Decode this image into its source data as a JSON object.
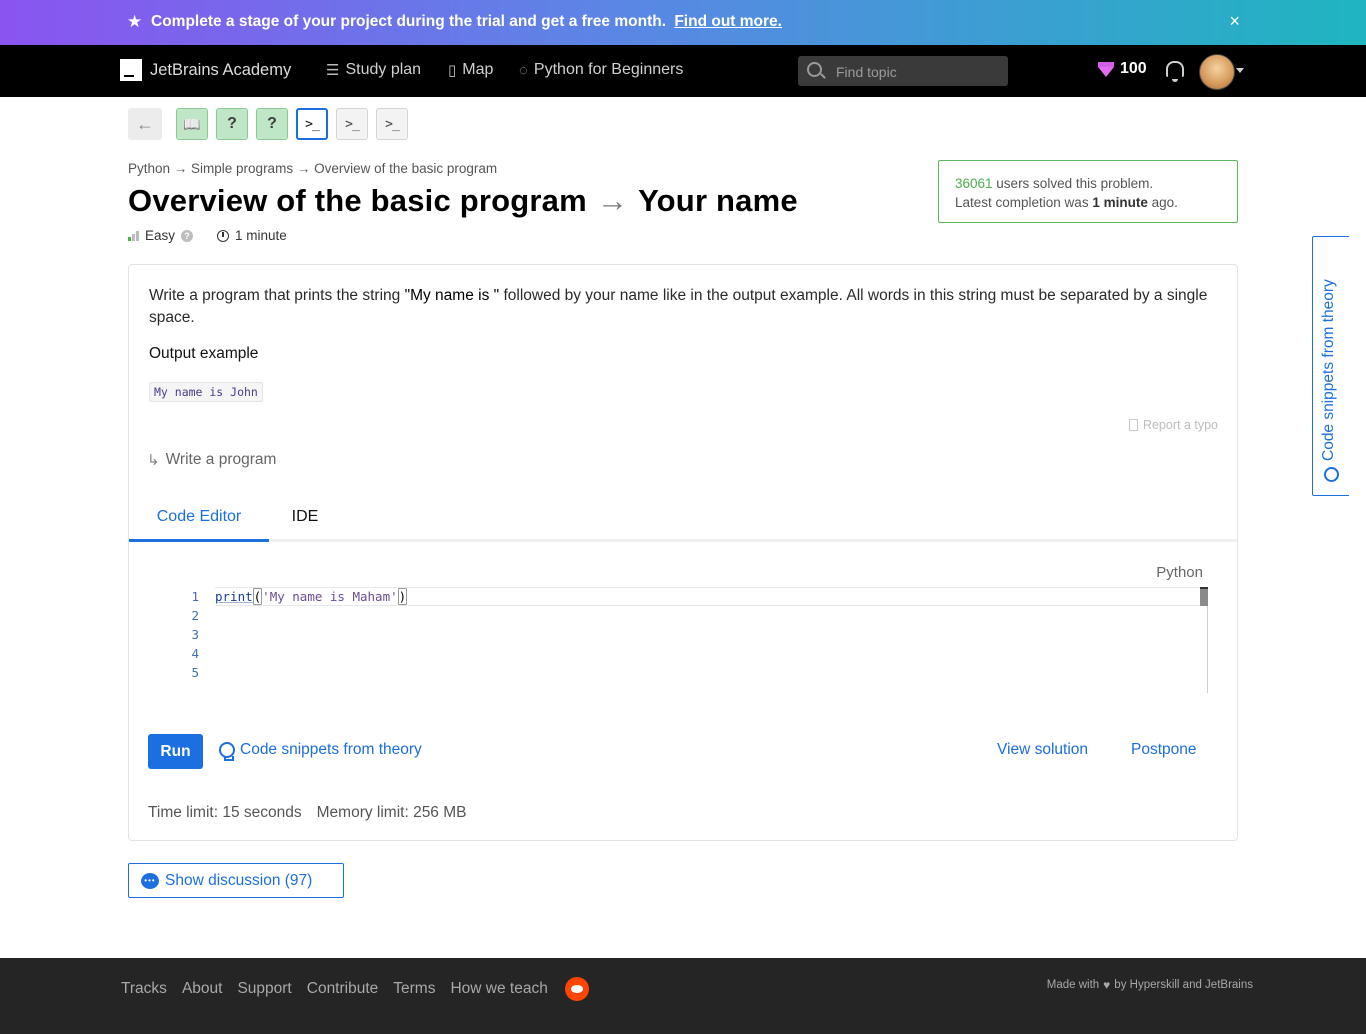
{
  "banner": {
    "text": "Complete a stage of your project during the trial and get a free month.",
    "link": "Find out more.",
    "close": "×"
  },
  "nav": {
    "brand": "JetBrains Academy",
    "study_plan": "Study plan",
    "map": "Map",
    "track": "Python for Beginners",
    "search_placeholder": "Find topic",
    "gems": "100"
  },
  "steps": [
    {
      "type": "theory",
      "state": "done",
      "glyph": "📖"
    },
    {
      "type": "quiz",
      "state": "done",
      "glyph": "?"
    },
    {
      "type": "quiz",
      "state": "done",
      "glyph": "?"
    },
    {
      "type": "code",
      "state": "current",
      "glyph": ">_"
    },
    {
      "type": "code",
      "state": "todo",
      "glyph": ">_"
    },
    {
      "type": "code",
      "state": "todo",
      "glyph": ">_"
    }
  ],
  "breadcrumb": "Python → Simple programs → Overview of the basic program",
  "title": {
    "topic": "Overview of the basic program",
    "arrow": "→",
    "problem": "Your name"
  },
  "meta": {
    "difficulty": "Easy",
    "time": "1 minute"
  },
  "solved": {
    "count": "36061",
    "line1_rest": " users solved this problem.",
    "line2_pre": "Latest completion was ",
    "line2_bold": "1 minute",
    "line2_post": " ago."
  },
  "task": {
    "desc_pre": "Write a program that prints the string ",
    "desc_quote": "\"My name is \"",
    "desc_post": " followed by your name like in the output example. All words in this string must be separated by a single space.",
    "output_heading": "Output example",
    "output_sample": "My name is John",
    "report_typo": "Report a typo",
    "write_program": "Write a program"
  },
  "tabs": {
    "editor": "Code Editor",
    "ide": "IDE"
  },
  "editor": {
    "language": "Python",
    "line_numbers": [
      "1",
      "2",
      "3",
      "4",
      "5"
    ],
    "code": {
      "fn": "print",
      "open": "(",
      "str": "'My name is Maham'",
      "close": ")"
    }
  },
  "actions": {
    "run": "Run",
    "snippets": "Code snippets from theory",
    "view_solution": "View solution",
    "postpone": "Postpone"
  },
  "limits": {
    "time": "Time limit: 15 seconds",
    "memory": "Memory limit: 256 MB"
  },
  "discussion": "Show discussion (97)",
  "sidetab": "Code snippets from theory",
  "footer": {
    "links": [
      "Tracks",
      "About",
      "Support",
      "Contribute",
      "Terms",
      "How we teach"
    ],
    "made_pre": "Made with",
    "made_post": "by Hyperskill and JetBrains"
  },
  "colors": {
    "accent": "#1c6fe0",
    "success": "#4caf50",
    "gem": "#e46cf0"
  }
}
